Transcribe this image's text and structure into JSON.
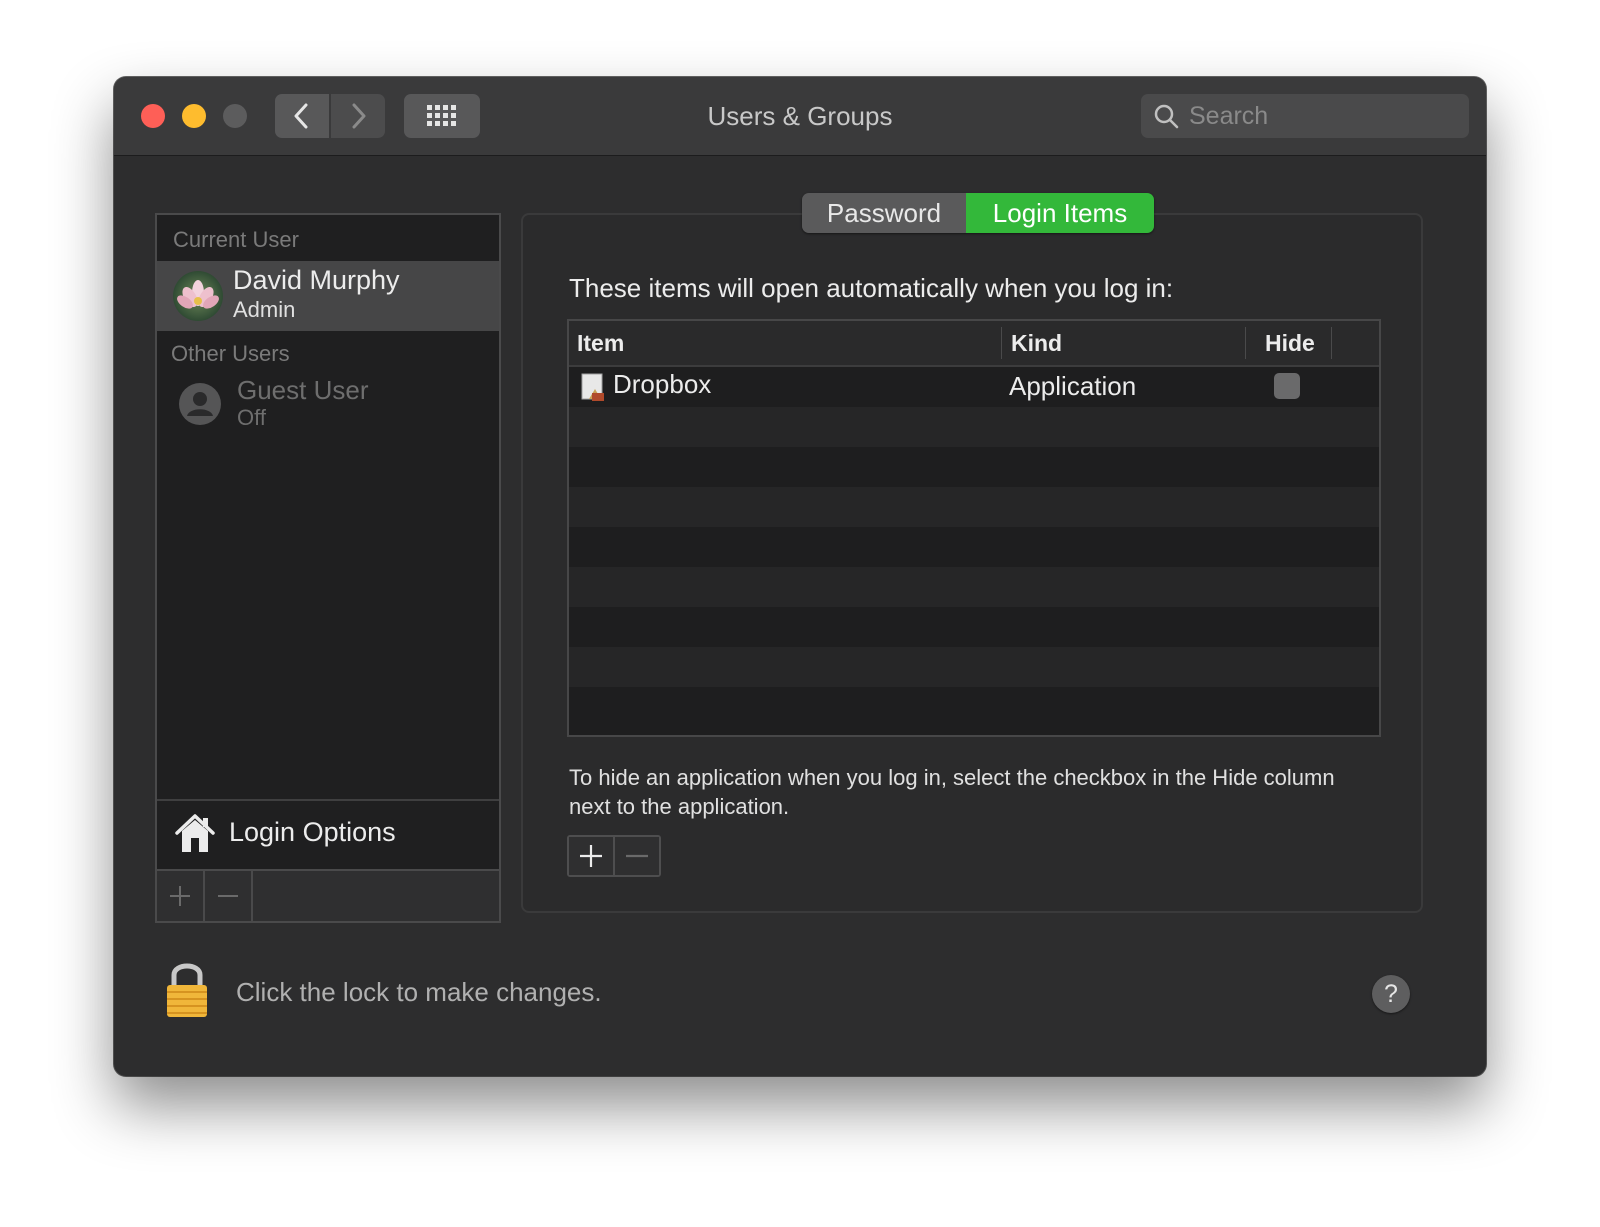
{
  "window": {
    "title": "Users & Groups"
  },
  "search": {
    "placeholder": "Search"
  },
  "users": {
    "current_header": "Current User",
    "current": {
      "name": "David Murphy",
      "role": "Admin"
    },
    "other_header": "Other Users",
    "others": [
      {
        "name": "Guest User",
        "status": "Off"
      }
    ],
    "login_options_label": "Login Options"
  },
  "tabs": [
    {
      "label": "Password",
      "selected": false
    },
    {
      "label": "Login Items",
      "selected": true
    }
  ],
  "login_items": {
    "intro": "These items will open automatically when you log in:",
    "columns": [
      "Item",
      "Kind",
      "Hide"
    ],
    "rows": [
      {
        "item": "Dropbox",
        "kind": "Application",
        "hide": false
      }
    ],
    "hint": "To hide an application when you log in, select the checkbox in the Hide column next to the application."
  },
  "footer": {
    "lock_text": "Click the lock to make changes.",
    "help_label": "?"
  },
  "colors": {
    "accent": "#33b83a",
    "close": "#fe5f57",
    "minimize": "#febc2e"
  }
}
